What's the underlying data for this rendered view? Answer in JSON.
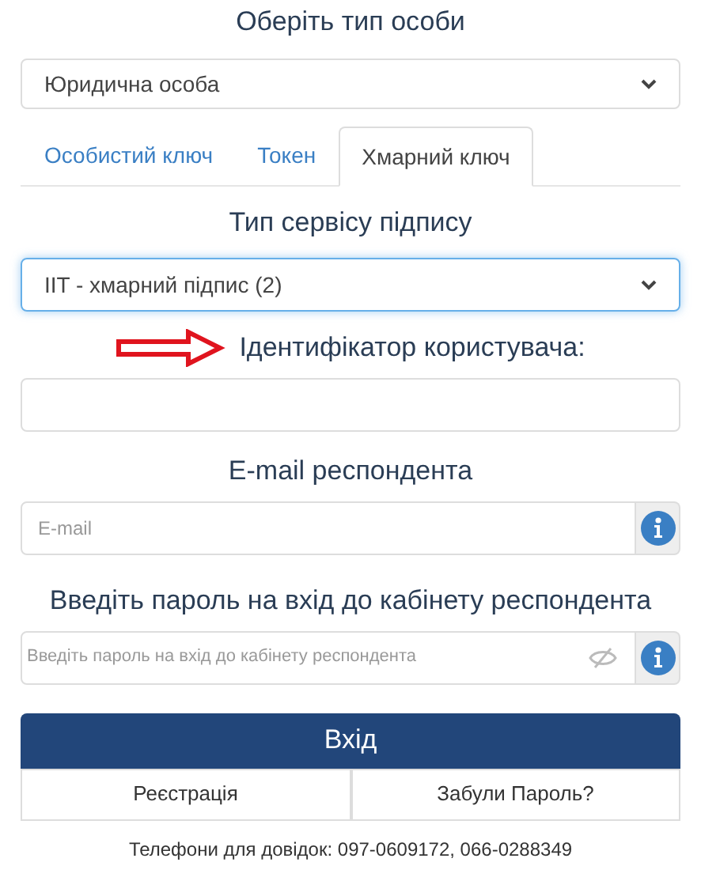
{
  "person_type": {
    "heading": "Оберіть тип особи",
    "value": "Юридична особа"
  },
  "tabs": [
    {
      "label": "Особистий ключ",
      "selected": false
    },
    {
      "label": "Токен",
      "selected": false
    },
    {
      "label": "Хмарний ключ",
      "selected": true
    }
  ],
  "service": {
    "heading": "Тип сервісу підпису",
    "value": "IIT - хмарний підпис (2)"
  },
  "user_id": {
    "label": "Ідентифікатор користувача:"
  },
  "email": {
    "heading": "E-mail респондента",
    "placeholder": "E-mail"
  },
  "password": {
    "heading": "Введіть пароль на вхід до кабінету респондента",
    "placeholder": "Введіть пароль на вхід до кабінету респондента"
  },
  "login_button": "Вхід",
  "secondary_buttons": [
    "Реєстрація",
    "Забули Пароль?"
  ],
  "phones": "Телефони для довідок: 097-0609172, 066-0288349"
}
